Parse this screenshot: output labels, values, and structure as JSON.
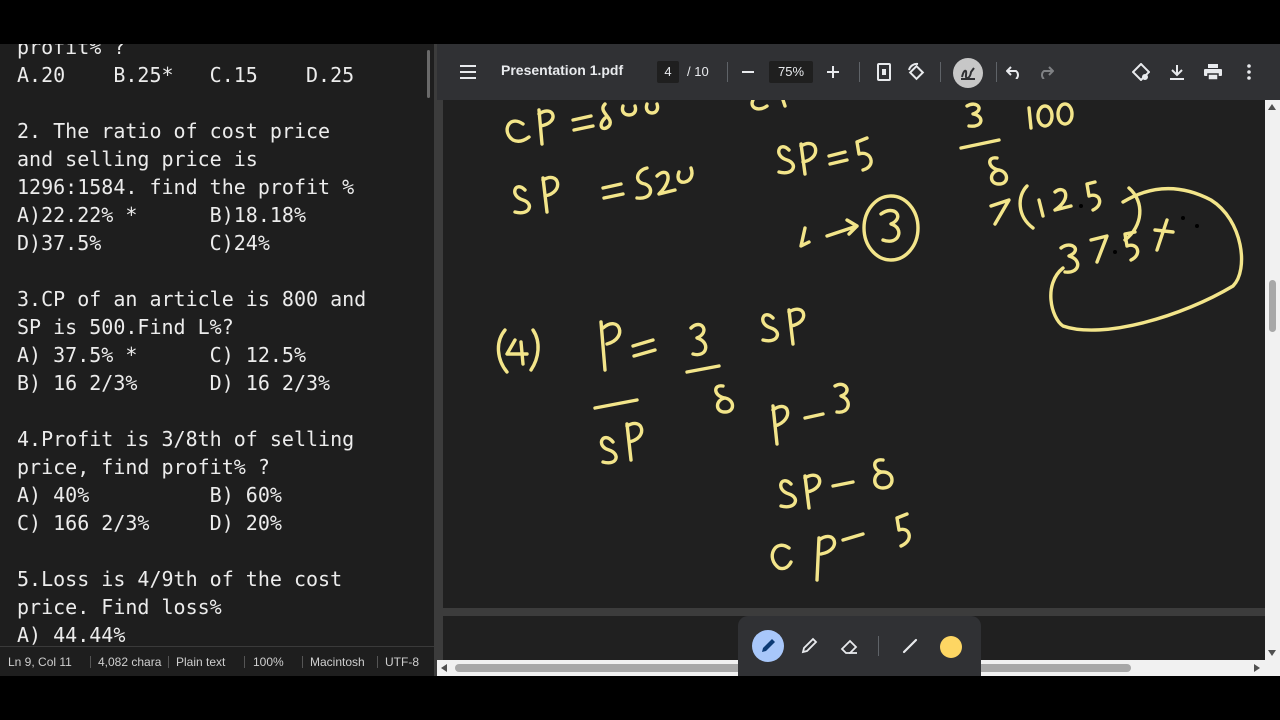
{
  "editor": {
    "lines": [
      "profit% ?",
      "A.20    B.25*   C.15    D.25",
      "",
      "2. The ratio of cost price",
      "and selling price is",
      "1296:1584. find the profit %",
      "A)22.22% *      B)18.18%",
      "D)37.5%         C)24%",
      "",
      "3.CP of an article is 800 and",
      "SP is 500.Find L%?",
      "A) 37.5% *      C) 12.5%",
      "B) 16 2/3%      D) 16 2/3%",
      "",
      "4.Profit is 3/8th of selling",
      "price, find profit% ?",
      "A) 40%          B) 60%",
      "C) 166 2/3%     D) 20%",
      "",
      "5.Loss is 4/9th of the cost",
      "price. Find loss%",
      "A) 44.44%"
    ],
    "status": {
      "position": "Ln 9, Col 11",
      "chars": "4,082 chara",
      "format": "Plain text",
      "zoom": "100%",
      "line_ending": "Macintosh",
      "encoding": "UTF-8"
    }
  },
  "viewer": {
    "title": "Presentation 1.pdf",
    "page_current": "4",
    "page_total": "/ 10",
    "zoom": "75%",
    "icons": {
      "menu": "menu-icon",
      "zoom_out": "zoom-out-icon",
      "zoom_in": "zoom-in-icon",
      "fit": "fit-page-icon",
      "rotate": "rotate-icon",
      "annotate": "annotate-icon",
      "undo": "undo-icon",
      "redo": "redo-icon",
      "ai": "ai-assist-icon",
      "download": "download-icon",
      "print": "print-icon",
      "more": "more-vert-icon"
    },
    "annotation_tools": [
      "pen-icon",
      "highlighter-icon",
      "eraser-icon",
      "line-thickness-icon",
      "color-picker"
    ],
    "ink_color": "#f3e58a",
    "highlight_color": "#fdd663"
  }
}
